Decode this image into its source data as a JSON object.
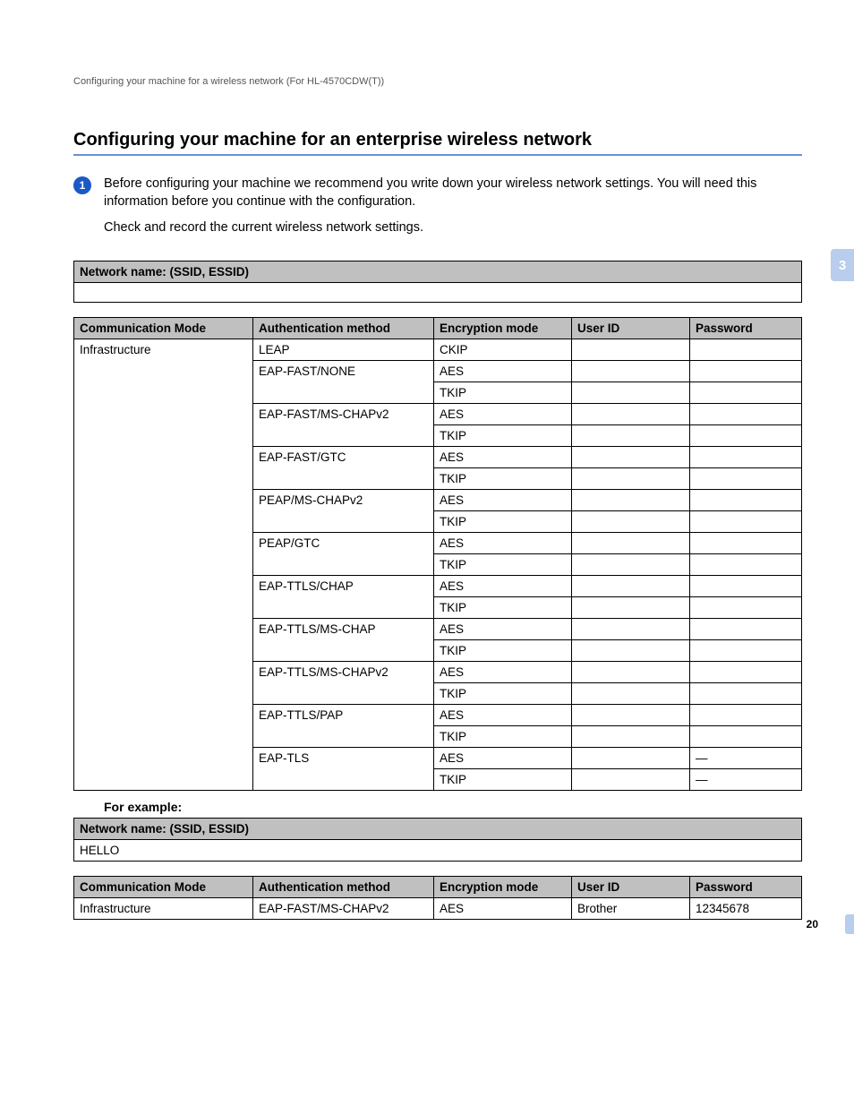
{
  "header": "Configuring your machine for a wireless network (For HL-4570CDW(T))",
  "heading": "Configuring your machine for an enterprise wireless network",
  "chapter_tab": "3",
  "step": {
    "num": "1",
    "p1": "Before configuring your machine we recommend you write down your wireless network settings. You will need this information before you continue with the configuration.",
    "p2": "Check and record the current wireless network settings."
  },
  "ssid_label": "Network name: (SSID, ESSID)",
  "cols": {
    "comm": "Communication Mode",
    "auth": "Authentication method",
    "enc": "Encryption mode",
    "uid": "User ID",
    "pwd": "Password"
  },
  "comm_mode_value": "Infrastructure",
  "auth_groups": [
    {
      "auth": "LEAP",
      "enc": [
        "CKIP"
      ],
      "pwd": [
        ""
      ]
    },
    {
      "auth": "EAP-FAST/NONE",
      "enc": [
        "AES",
        "TKIP"
      ],
      "pwd": [
        "",
        ""
      ]
    },
    {
      "auth": "EAP-FAST/MS-CHAPv2",
      "enc": [
        "AES",
        "TKIP"
      ],
      "pwd": [
        "",
        ""
      ]
    },
    {
      "auth": "EAP-FAST/GTC",
      "enc": [
        "AES",
        "TKIP"
      ],
      "pwd": [
        "",
        ""
      ]
    },
    {
      "auth": "PEAP/MS-CHAPv2",
      "enc": [
        "AES",
        "TKIP"
      ],
      "pwd": [
        "",
        ""
      ]
    },
    {
      "auth": "PEAP/GTC",
      "enc": [
        "AES",
        "TKIP"
      ],
      "pwd": [
        "",
        ""
      ]
    },
    {
      "auth": "EAP-TTLS/CHAP",
      "enc": [
        "AES",
        "TKIP"
      ],
      "pwd": [
        "",
        ""
      ]
    },
    {
      "auth": "EAP-TTLS/MS-CHAP",
      "enc": [
        "AES",
        "TKIP"
      ],
      "pwd": [
        "",
        ""
      ]
    },
    {
      "auth": "EAP-TTLS/MS-CHAPv2",
      "enc": [
        "AES",
        "TKIP"
      ],
      "pwd": [
        "",
        ""
      ]
    },
    {
      "auth": "EAP-TTLS/PAP",
      "enc": [
        "AES",
        "TKIP"
      ],
      "pwd": [
        "",
        ""
      ]
    },
    {
      "auth": "EAP-TLS",
      "enc": [
        "AES",
        "TKIP"
      ],
      "pwd": [
        "—",
        "—"
      ]
    }
  ],
  "for_example": "For example:",
  "example": {
    "ssid": "HELLO",
    "row": {
      "comm": "Infrastructure",
      "auth": "EAP-FAST/MS-CHAPv2",
      "enc": "AES",
      "uid": "Brother",
      "pwd": "12345678"
    }
  },
  "page_number": "20"
}
